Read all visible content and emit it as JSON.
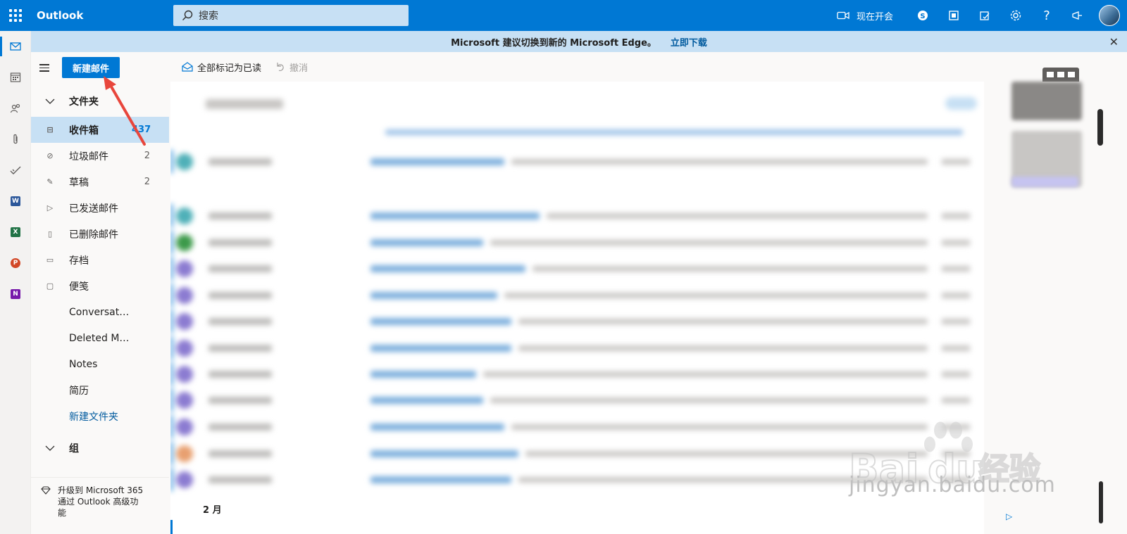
{
  "app": {
    "name": "Outlook"
  },
  "search": {
    "placeholder": "搜索"
  },
  "topbar": {
    "meet_now_label": "现在开会"
  },
  "banner": {
    "text": "Microsoft 建议切换到新的 Microsoft Edge。",
    "link": "立即下载"
  },
  "compose": {
    "new_mail_label": "新建邮件"
  },
  "commands": {
    "mark_all_read": "全部标记为已读",
    "undo": "撤消"
  },
  "folders_header": "文件夹",
  "folders": [
    {
      "name": "收件箱",
      "count": "437",
      "icon": "inbox-icon",
      "selected": true
    },
    {
      "name": "垃圾邮件",
      "count": "2",
      "icon": "junk-icon"
    },
    {
      "name": "草稿",
      "count": "2",
      "icon": "pencil-icon"
    },
    {
      "name": "已发送邮件",
      "count": "",
      "icon": "send-icon"
    },
    {
      "name": "已删除邮件",
      "count": "",
      "icon": "trash-icon"
    },
    {
      "name": "存档",
      "count": "",
      "icon": "archive-icon"
    },
    {
      "name": "便笺",
      "count": "",
      "icon": "note-icon"
    },
    {
      "name": "Conversation Hi...",
      "count": ""
    },
    {
      "name": "Deleted Messag...",
      "count": ""
    },
    {
      "name": "Notes",
      "count": ""
    },
    {
      "name": "简历",
      "count": ""
    },
    {
      "name": "新建文件夹",
      "count": "",
      "link": true
    }
  ],
  "groups_header": "组",
  "upgrade": {
    "line1": "升级到 Microsoft 365",
    "line2": "通过 Outlook 高级功",
    "line3": "能"
  },
  "message_list": {
    "month_label": "2 月"
  },
  "rail_apps": [
    {
      "name": "mail-icon"
    },
    {
      "name": "calendar-icon"
    },
    {
      "name": "people-icon"
    },
    {
      "name": "attachment-icon"
    },
    {
      "name": "todo-icon"
    },
    {
      "name": "word-icon",
      "letter": "W",
      "color": "#2b579a"
    },
    {
      "name": "excel-icon",
      "letter": "X",
      "color": "#217346"
    },
    {
      "name": "powerpoint-icon",
      "letter": "P",
      "color": "#d24726"
    },
    {
      "name": "onenote-icon",
      "letter": "N",
      "color": "#7719aa"
    }
  ],
  "watermark": {
    "text": "jingyan.baidu.com"
  },
  "colors": {
    "brand": "#0078d4",
    "banner": "#c7e0f4",
    "arrow": "#e8463c"
  }
}
